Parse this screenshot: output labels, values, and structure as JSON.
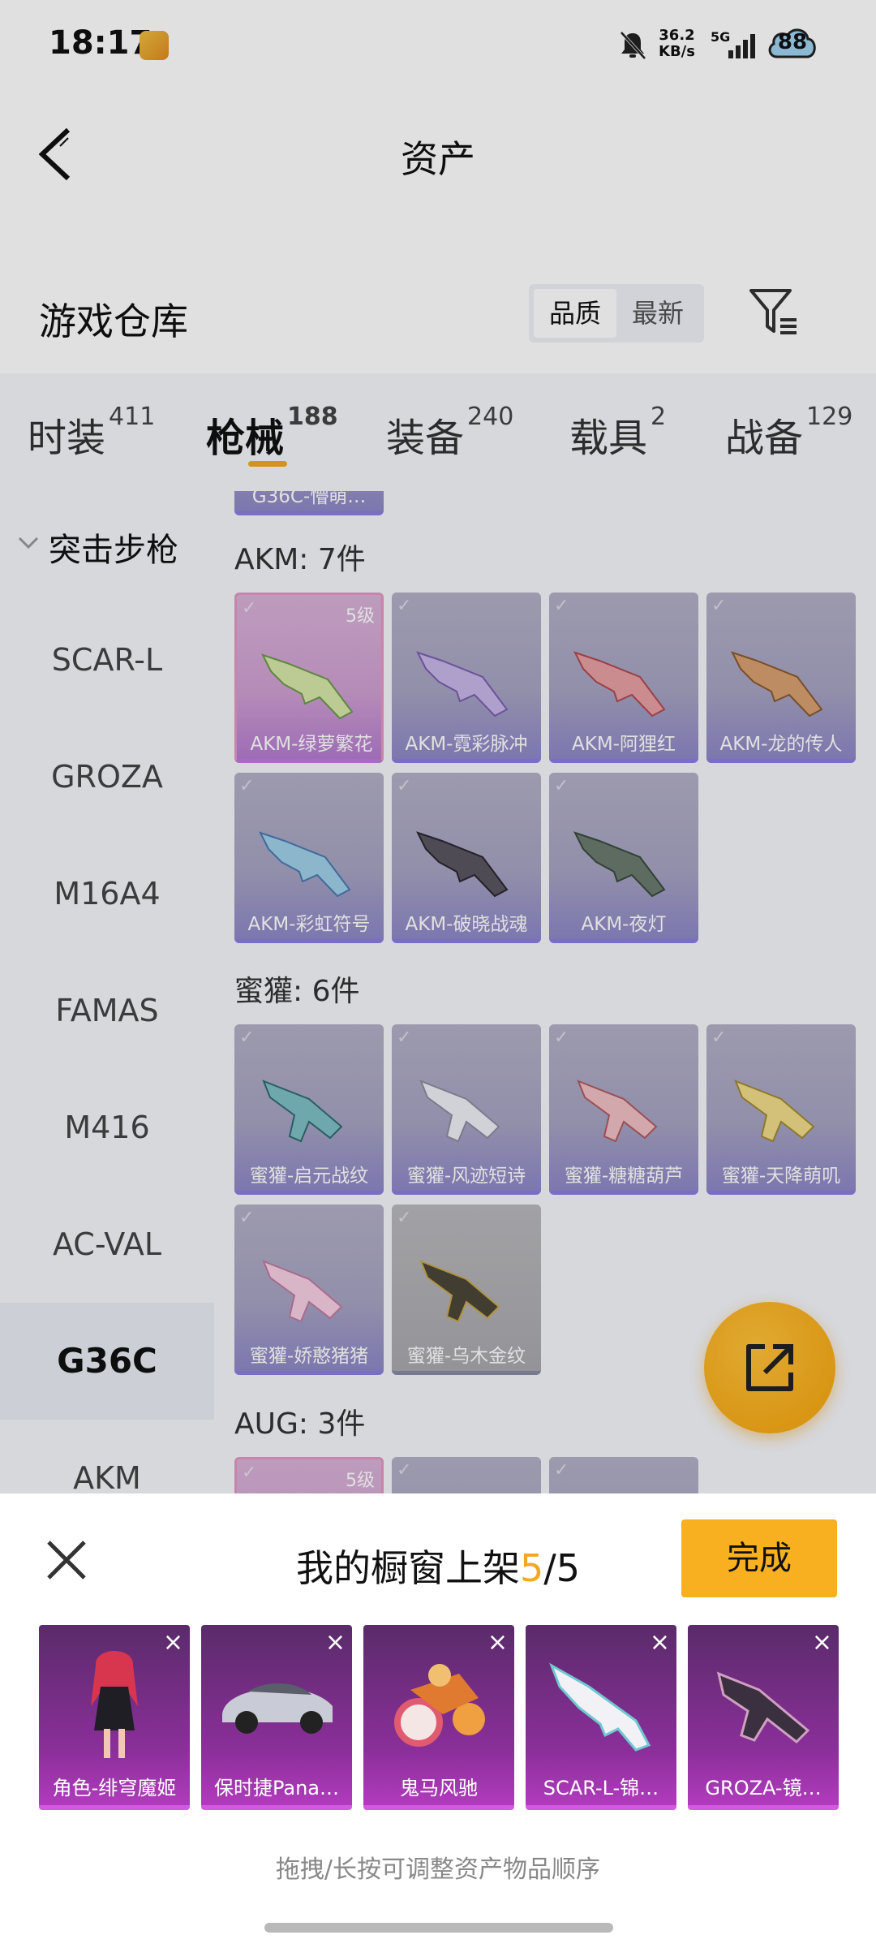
{
  "status": {
    "time": "18:17",
    "speed_top": "36.2",
    "speed_bottom": "KB/s",
    "network": "5G",
    "battery": "88"
  },
  "header": {
    "title": "资产"
  },
  "section": {
    "title": "游戏仓库",
    "sort_quality": "品质",
    "sort_newest": "最新"
  },
  "tabs": [
    {
      "label": "时装",
      "count": "411"
    },
    {
      "label": "枪械",
      "count": "188"
    },
    {
      "label": "装备",
      "count": "240"
    },
    {
      "label": "载具",
      "count": "2"
    },
    {
      "label": "战备",
      "count": "129"
    }
  ],
  "sidebar": {
    "group": "突击步枪",
    "items": [
      "SCAR-L",
      "GROZA",
      "M16A4",
      "FAMAS",
      "M416",
      "AC-VAL",
      "G36C",
      "AKM"
    ]
  },
  "partial_top_card": "G36C-懵萌…",
  "groups": [
    {
      "title": "AKM: 7件",
      "items": [
        {
          "name": "AKM-绿萝繁花",
          "level": "5级"
        },
        {
          "name": "AKM-霓彩脉冲",
          "level": ""
        },
        {
          "name": "AKM-阿狸红",
          "level": ""
        },
        {
          "name": "AKM-龙的传人",
          "level": ""
        },
        {
          "name": "AKM-彩虹符号",
          "level": ""
        },
        {
          "name": "AKM-破晓战魂",
          "level": ""
        },
        {
          "name": "AKM-夜灯",
          "level": ""
        }
      ]
    },
    {
      "title": "蜜獾: 6件",
      "items": [
        {
          "name": "蜜獾-启元战纹",
          "level": ""
        },
        {
          "name": "蜜獾-风迹短诗",
          "level": ""
        },
        {
          "name": "蜜獾-糖糖葫芦",
          "level": ""
        },
        {
          "name": "蜜獾-天降萌叽",
          "level": ""
        },
        {
          "name": "蜜獾-娇憨猪猪",
          "level": ""
        },
        {
          "name": "蜜獾-乌木金纹",
          "level": ""
        }
      ]
    },
    {
      "title": "AUG: 3件",
      "items": [
        {
          "name": "",
          "level": "5级"
        },
        {
          "name": "",
          "level": ""
        },
        {
          "name": "",
          "level": ""
        }
      ]
    }
  ],
  "panel": {
    "title_prefix": "我的橱窗上架",
    "count_current": "5",
    "count_total": "/5",
    "done_label": "完成",
    "close_glyph": "×",
    "items": [
      "角色-绯穹魔姬",
      "保时捷Pana…",
      "鬼马风驰",
      "SCAR-L-锦…",
      "GROZA-镜…"
    ],
    "hint": "拖拽/长按可调整资产物品顺序"
  },
  "colors": {
    "accent": "#f5a623",
    "tab_bg": "#f4f6fb",
    "card_purple": "#a6a3c2",
    "shelf_magenta": "#8b2f9a"
  }
}
